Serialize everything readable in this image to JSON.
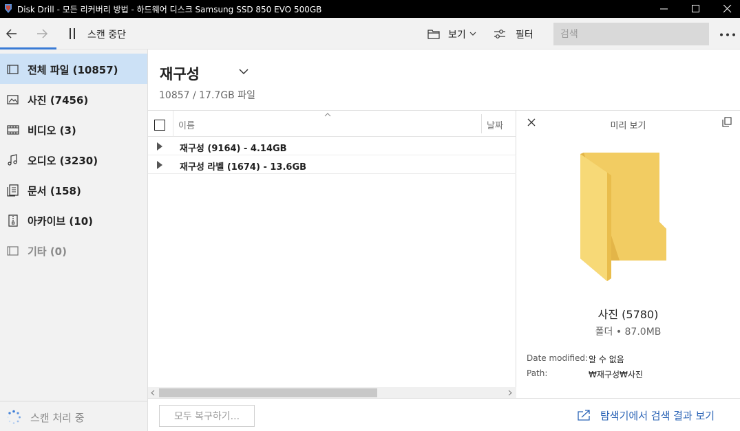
{
  "window": {
    "title": "Disk Drill - 모든 리커버리 방법 - 하드웨어 디스크 Samsung SSD 850 EVO 500GB"
  },
  "toolbar": {
    "scan_stop_label": "스캔 중단",
    "view_label": "보기",
    "filter_label": "필터",
    "search_placeholder": "검색",
    "accent": "#3a7bd5"
  },
  "sidebar": {
    "items": [
      {
        "label": "전체 파일 (10857)",
        "icon": "all-files-icon",
        "active": true
      },
      {
        "label": "사진 (7456)",
        "icon": "photo-icon"
      },
      {
        "label": "비디오 (3)",
        "icon": "video-icon"
      },
      {
        "label": "오디오 (3230)",
        "icon": "music-note-icon"
      },
      {
        "label": "문서 (158)",
        "icon": "document-icon"
      },
      {
        "label": "아카이브 (10)",
        "icon": "archive-icon"
      },
      {
        "label": "기타 (0)",
        "icon": "other-icon",
        "muted": true
      }
    ],
    "status": "스캔 처리 중"
  },
  "main": {
    "title": "재구성",
    "subtitle": "10857 / 17.7GB 파일",
    "columns": {
      "name": "이름",
      "date": "날짜"
    },
    "rows": [
      {
        "label": "재구성 (9164) - 4.14GB"
      },
      {
        "label": "재구성 라벨 (1674) - 13.6GB"
      }
    ]
  },
  "preview": {
    "title": "미리 보기",
    "name": "사진 (5780)",
    "meta": "폴더 • 87.0MB",
    "date_label": "Date modified:",
    "date_value": "알 수 없음",
    "path_label": "Path:",
    "path_value": "₩재구성₩사진"
  },
  "bottom": {
    "recover_all": "모두 복구하기...",
    "explore": "탐색기에서 검색 결과 보기",
    "link_color": "#2a63b6"
  }
}
